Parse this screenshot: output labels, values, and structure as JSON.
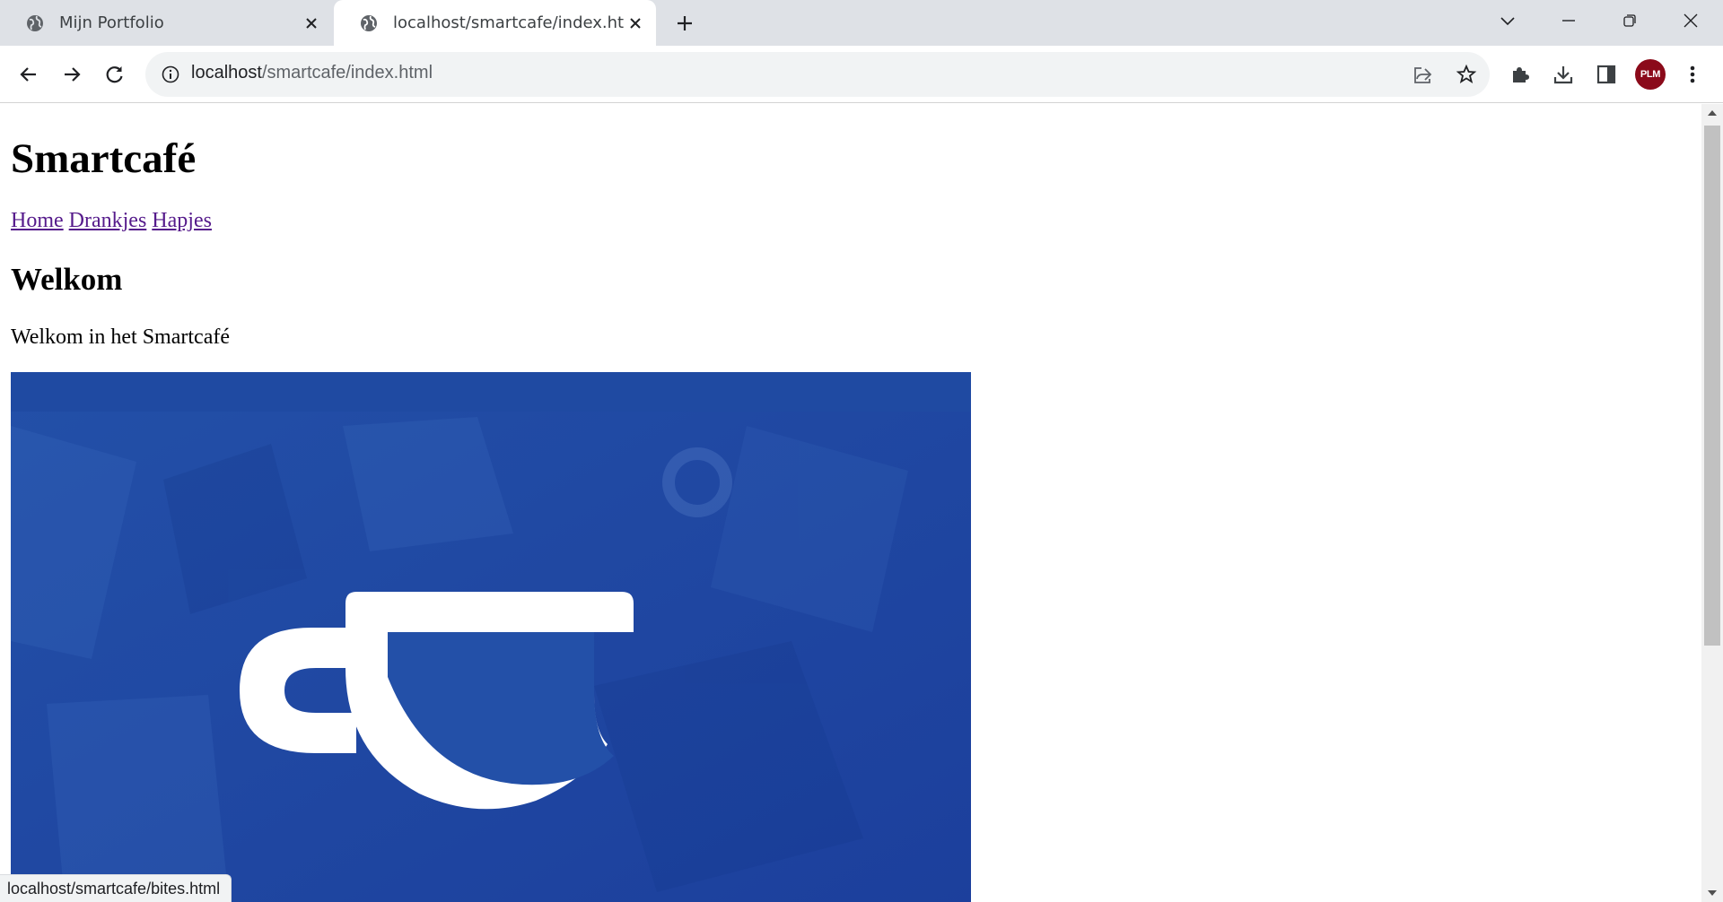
{
  "browser": {
    "tabs": [
      {
        "title": "Mijn Portfolio",
        "active": false
      },
      {
        "title": "localhost/smartcafe/index.html",
        "active": true
      }
    ],
    "address": {
      "host": "localhost",
      "path": "/smartcafe/index.html"
    },
    "profile_initials": "PLM",
    "status_url": "localhost/smartcafe/bites.html"
  },
  "page": {
    "title": "Smartcafé",
    "nav": [
      "Home",
      "Drankjes",
      "Hapjes"
    ],
    "heading": "Welkom",
    "intro": "Welkom in het Smartcafé"
  },
  "colors": {
    "tabstrip": "#dee1e6",
    "visited_link": "#551a8b",
    "hero_blue": "#1f48a4",
    "avatar": "#8b0a1a"
  },
  "icons": [
    "globe-icon",
    "close-icon",
    "plus-icon",
    "chevron-down-icon",
    "minimize-icon",
    "restore-icon",
    "back-icon",
    "forward-icon",
    "reload-icon",
    "info-icon",
    "share-icon",
    "star-icon",
    "puzzle-icon",
    "download-icon",
    "sidepanel-icon",
    "kebab-menu-icon",
    "cup-logo"
  ]
}
